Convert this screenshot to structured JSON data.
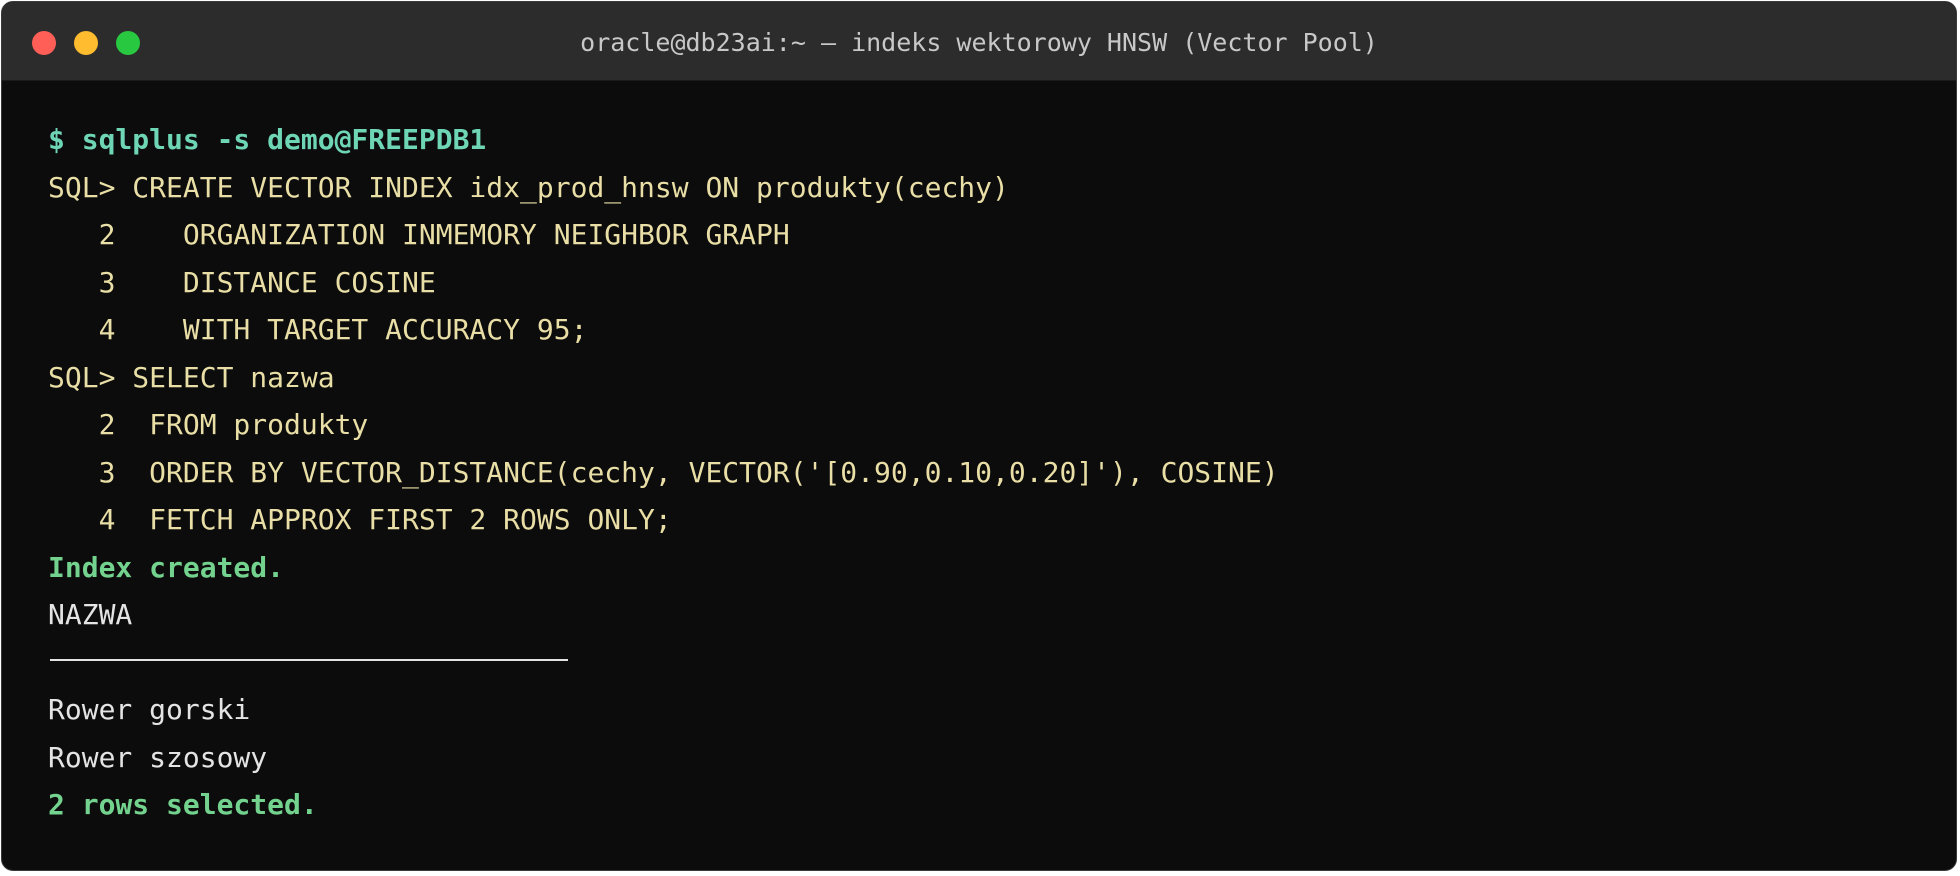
{
  "window": {
    "title": "oracle@db23ai:~ — indeks wektorowy HNSW (Vector Pool)"
  },
  "terminal": {
    "prompt_command": "$ sqlplus -s demo@FREEPDB1",
    "statement1": [
      "SQL> CREATE VECTOR INDEX idx_prod_hnsw ON produkty(cechy)",
      "   2    ORGANIZATION INMEMORY NEIGHBOR GRAPH",
      "   3    DISTANCE COSINE",
      "   4    WITH TARGET ACCURACY 95;"
    ],
    "statement2": [
      "SQL> SELECT nazwa",
      "   2  FROM produkty",
      "   3  ORDER BY VECTOR_DISTANCE(cechy, VECTOR('[0.90,0.10,0.20]'), COSINE)",
      "   4  FETCH APPROX FIRST 2 ROWS ONLY;"
    ],
    "index_result": "Index created.",
    "column_header": "NAZWA",
    "rows": [
      "Rower gorski",
      "Rower szosowy"
    ],
    "rows_result": "2 rows selected."
  },
  "colors": {
    "background": "#0c0c0c",
    "titlebar": "#2c2c2c",
    "sql_text": "#e9dfa6",
    "command": "#6ed6b5",
    "success": "#72d28e",
    "output": "#e4e4e4"
  }
}
